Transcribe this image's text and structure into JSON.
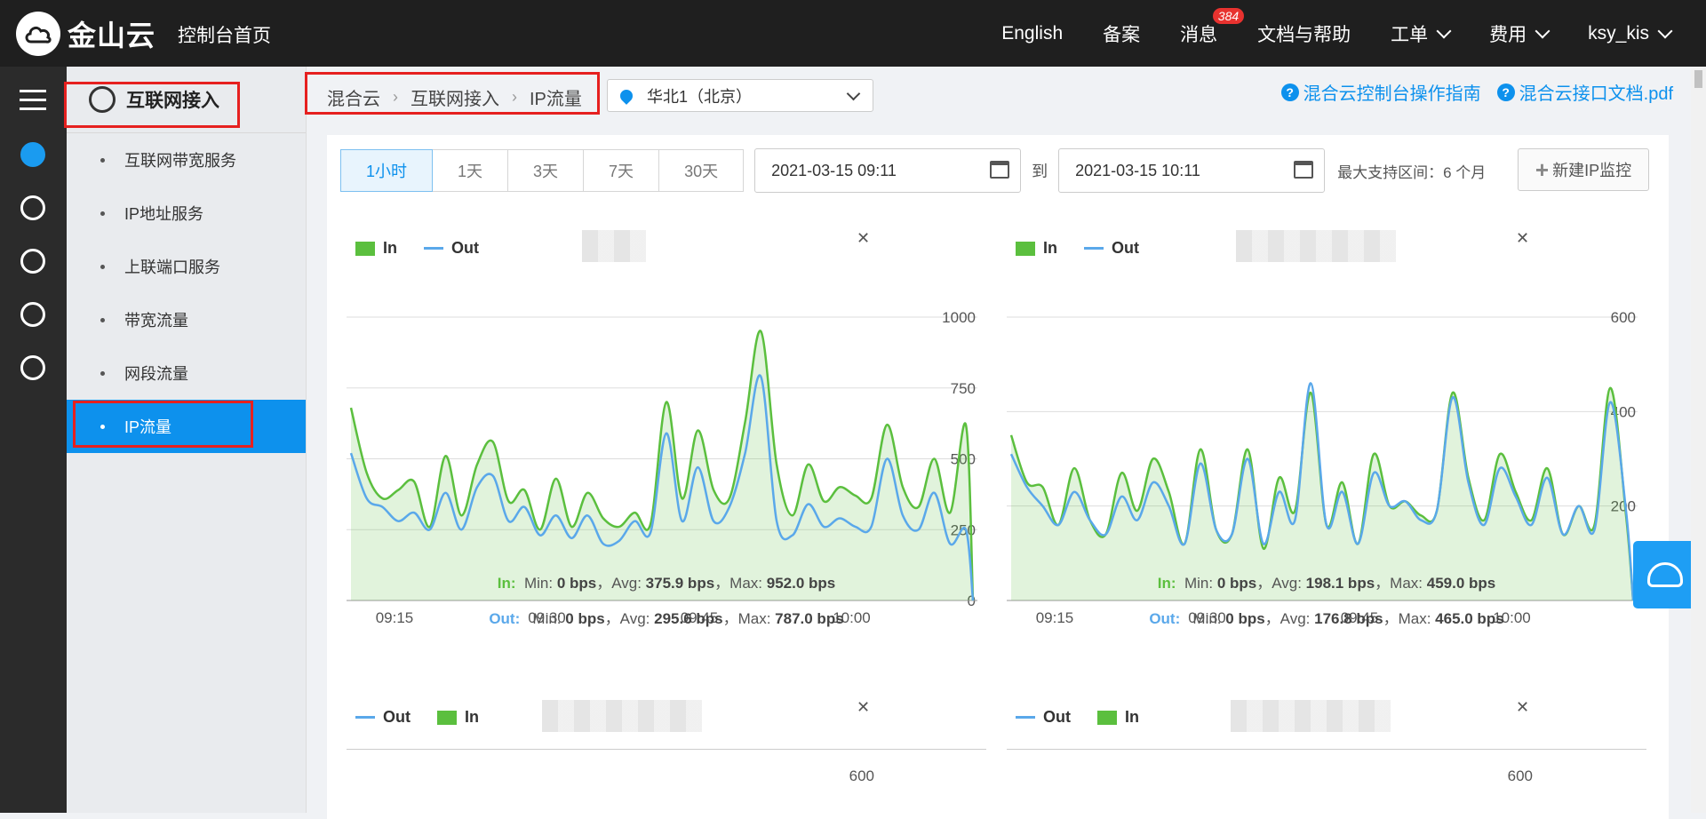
{
  "topbar": {
    "brand": "金山云",
    "home": "控制台首页",
    "nav": [
      {
        "label": "English",
        "chevron": false
      },
      {
        "label": "备案",
        "chevron": false
      },
      {
        "label": "消息",
        "chevron": false,
        "badge": "384"
      },
      {
        "label": "文档与帮助",
        "chevron": false
      },
      {
        "label": "工单",
        "chevron": true
      },
      {
        "label": "费用",
        "chevron": true
      },
      {
        "label": "ksy_kis",
        "chevron": true
      }
    ]
  },
  "sidebar": {
    "title": "互联网接入",
    "items": [
      {
        "label": "互联网带宽服务",
        "active": false
      },
      {
        "label": "IP地址服务",
        "active": false
      },
      {
        "label": "上联端口服务",
        "active": false
      },
      {
        "label": "带宽流量",
        "active": false
      },
      {
        "label": "网段流量",
        "active": false
      },
      {
        "label": "IP流量",
        "active": true
      }
    ]
  },
  "breadcrumb": [
    "混合云",
    "互联网接入",
    "IP流量"
  ],
  "region": {
    "label": "华北1（北京）"
  },
  "help_links": [
    "混合云控制台操作指南",
    "混合云接口文档.pdf"
  ],
  "time_range": {
    "buttons": [
      "1小时",
      "1天",
      "3天",
      "7天",
      "30天"
    ],
    "active_index": 0,
    "start": "2021-03-15 09:11",
    "to_label": "到",
    "end": "2021-03-15 10:11",
    "max_label": "最大支持区间：6 个月",
    "new_button": "新建IP监控"
  },
  "colors": {
    "in": "#5bbf3e",
    "out": "#5aa8ea",
    "accent": "#0d91ed"
  },
  "chart_data": [
    {
      "type": "area",
      "legend": [
        "In",
        "Out"
      ],
      "x_ticks": [
        "09:15",
        "09:30",
        "09:45",
        "10:00"
      ],
      "y_ticks": [
        "1000",
        "750",
        "500",
        "250",
        "0"
      ],
      "ylim": [
        0,
        1000
      ],
      "x": [
        9.1,
        9.2,
        9.3,
        9.4,
        9.5,
        9.6,
        9.7,
        9.8,
        9.9,
        10.0,
        10.1,
        10.2,
        10.3,
        10.4,
        10.5,
        10.6,
        10.7,
        10.8,
        10.9,
        11.0,
        11.1,
        11.2,
        11.3,
        11.4,
        11.5,
        11.6,
        11.7,
        11.8,
        11.9,
        12.0,
        12.1,
        12.2,
        12.3,
        12.4,
        12.5,
        12.6,
        12.7,
        12.8,
        12.9,
        13.0
      ],
      "series": [
        {
          "name": "In",
          "values": [
            680,
            450,
            360,
            390,
            420,
            260,
            510,
            300,
            480,
            560,
            350,
            390,
            250,
            430,
            260,
            380,
            290,
            260,
            310,
            270,
            700,
            360,
            600,
            390,
            360,
            630,
            950,
            480,
            300,
            480,
            350,
            400,
            370,
            360,
            620,
            400,
            330,
            500,
            310,
            620
          ]
        },
        {
          "name": "Out",
          "values": [
            520,
            360,
            330,
            280,
            310,
            250,
            380,
            250,
            400,
            440,
            280,
            330,
            230,
            300,
            220,
            300,
            200,
            210,
            280,
            240,
            590,
            280,
            470,
            280,
            330,
            520,
            790,
            280,
            230,
            340,
            260,
            290,
            260,
            260,
            500,
            300,
            250,
            380,
            200,
            250
          ]
        }
      ],
      "stats": {
        "in": {
          "label": "In:",
          "min": "0 bps",
          "avg": "375.9 bps",
          "max": "952.0 bps"
        },
        "out": {
          "label": "Out:",
          "min": "0 bps",
          "avg": "295.6 bps",
          "max": "787.0 bps"
        }
      }
    },
    {
      "type": "area",
      "legend": [
        "In",
        "Out"
      ],
      "x_ticks": [
        "09:15",
        "09:30",
        "09:45",
        "10:00"
      ],
      "y_ticks": [
        "600",
        "400",
        "200"
      ],
      "ylim": [
        0,
        600
      ],
      "x": [
        9.1,
        9.2,
        9.3,
        9.4,
        9.5,
        9.6,
        9.7,
        9.8,
        9.9,
        10.0,
        10.1,
        10.2,
        10.3,
        10.4,
        10.5,
        10.6,
        10.7,
        10.8,
        10.9,
        11.0,
        11.1,
        11.2,
        11.3,
        11.4,
        11.5,
        11.6,
        11.7,
        11.8,
        11.9,
        12.0,
        12.1,
        12.2,
        12.3,
        12.4,
        12.5,
        12.6,
        12.7,
        12.8,
        12.9,
        13.0
      ],
      "series": [
        {
          "name": "In",
          "values": [
            350,
            250,
            240,
            160,
            280,
            170,
            140,
            270,
            190,
            300,
            230,
            120,
            320,
            150,
            140,
            320,
            110,
            260,
            190,
            440,
            160,
            250,
            120,
            310,
            200,
            210,
            180,
            190,
            440,
            260,
            170,
            310,
            230,
            170,
            280,
            140,
            200,
            160,
            450,
            180
          ]
        },
        {
          "name": "Out",
          "values": [
            310,
            240,
            200,
            160,
            230,
            170,
            140,
            220,
            170,
            250,
            200,
            120,
            290,
            150,
            140,
            300,
            120,
            230,
            170,
            460,
            160,
            230,
            120,
            270,
            200,
            210,
            170,
            190,
            430,
            250,
            160,
            280,
            220,
            160,
            260,
            140,
            200,
            150,
            420,
            190
          ]
        }
      ],
      "stats": {
        "in": {
          "label": "In:",
          "min": "0 bps",
          "avg": "198.1 bps",
          "max": "459.0 bps"
        },
        "out": {
          "label": "Out:",
          "min": "0 bps",
          "avg": "176.8 bps",
          "max": "465.0 bps"
        }
      }
    },
    {
      "type": "area",
      "legend": [
        "Out",
        "In"
      ],
      "y_ticks": [
        "600"
      ],
      "ylim": [
        0,
        600
      ]
    },
    {
      "type": "area",
      "legend": [
        "Out",
        "In"
      ],
      "y_ticks": [
        "600"
      ],
      "ylim": [
        0,
        600
      ]
    }
  ]
}
